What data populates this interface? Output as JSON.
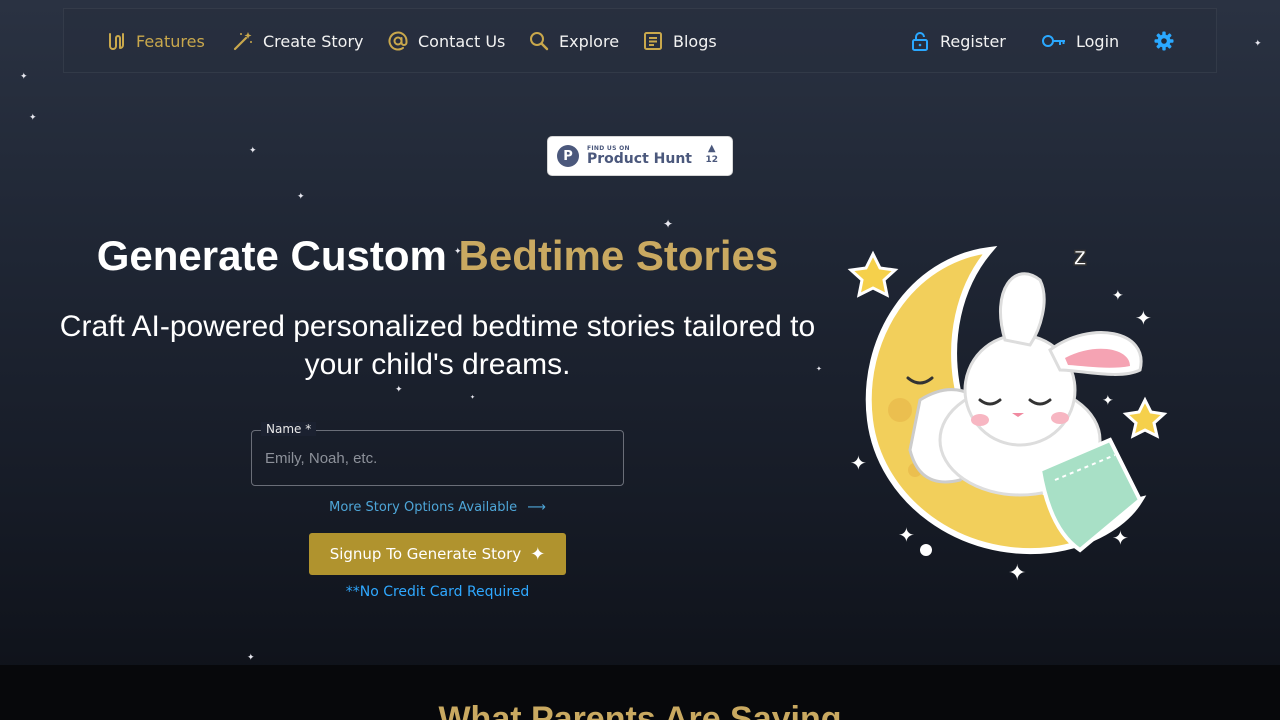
{
  "nav": {
    "items": [
      {
        "label": "Features",
        "icon": "features-icon",
        "active": true
      },
      {
        "label": "Create Story",
        "icon": "magic-wand-icon"
      },
      {
        "label": "Contact Us",
        "icon": "at-sign-icon"
      },
      {
        "label": "Explore",
        "icon": "search-icon"
      },
      {
        "label": "Blogs",
        "icon": "document-icon"
      }
    ],
    "register_label": "Register",
    "login_label": "Login",
    "settings_icon": "gear-icon"
  },
  "product_hunt": {
    "small": "FIND US ON",
    "big": "Product Hunt",
    "letter": "P",
    "votes": "12"
  },
  "hero": {
    "title_main": "Generate Custom ",
    "title_accent": "Bedtime Stories",
    "subtitle": "Craft AI-powered personalized bedtime stories tailored to your child's dreams."
  },
  "form": {
    "name_label": "Name *",
    "name_placeholder": "Emily, Noah, etc.",
    "name_value": "",
    "more_options": "More Story Options Available",
    "cta": "Signup To Generate Story",
    "no_cc": "**No Credit Card Required"
  },
  "sections": {
    "parents_title": "What Parents Are Saying"
  },
  "colors": {
    "accent_gold": "#c9a961",
    "cta_gold": "#b0932e",
    "link_blue": "#4ea6d8",
    "icon_blue": "#2aa8ff"
  }
}
